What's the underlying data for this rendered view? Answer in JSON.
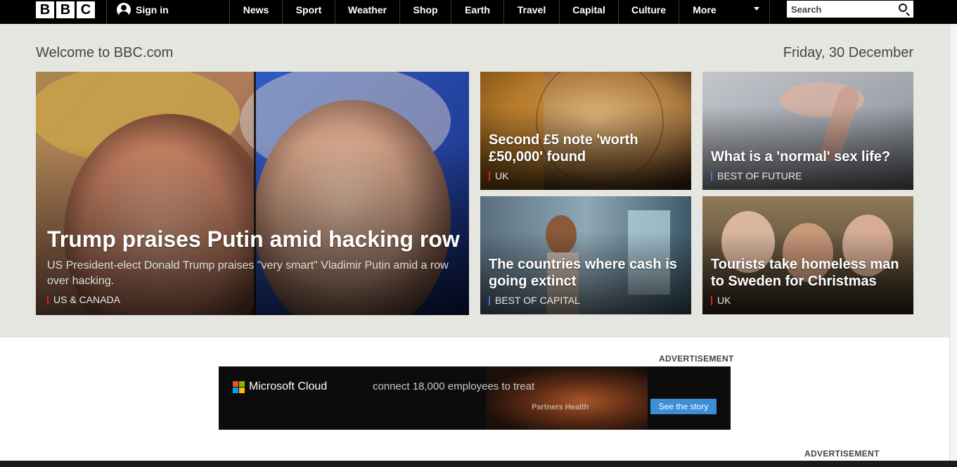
{
  "header": {
    "logo_letters": [
      "B",
      "B",
      "C"
    ],
    "sign_in": "Sign in",
    "nav": [
      "News",
      "Sport",
      "Weather",
      "Shop",
      "Earth",
      "Travel",
      "Capital",
      "Culture",
      "More"
    ],
    "search_placeholder": "Search"
  },
  "welcome": "Welcome to BBC.com",
  "date": "Friday, 30 December",
  "stories": {
    "main": {
      "headline": "Trump praises Putin amid hacking row",
      "summary": "US President-elect Donald Trump praises \"very smart\" Vladimir Putin amid a row over hacking.",
      "tag": "US & CANADA",
      "tag_color": "#e0201b"
    },
    "tiles": [
      {
        "headline": "Second £5 note 'worth £50,000' found",
        "tag": "UK",
        "tag_color": "#e0201b"
      },
      {
        "headline": "What is a 'normal' sex life?",
        "tag": "BEST OF FUTURE",
        "tag_color": "#3b7dc6"
      },
      {
        "headline": "The countries where cash is going extinct",
        "tag": "BEST OF CAPITAL",
        "tag_color": "#3b7dc6"
      },
      {
        "headline": "Tourists take homeless man to Sweden for Christmas",
        "tag": "UK",
        "tag_color": "#e0201b"
      }
    ]
  },
  "ads": {
    "label": "ADVERTISEMENT",
    "brand": "Microsoft Cloud",
    "tagline": "connect 18,000 employees to treat",
    "cta": "See the story",
    "photo_text": "Partners Health",
    "ms_colors": [
      "#f25022",
      "#7fba00",
      "#00a4ef",
      "#ffb900"
    ]
  },
  "colors": {
    "topbar": "#000000",
    "hero_background": "#e6e6e1",
    "accent_red": "#e0201b",
    "accent_blue": "#3b7dc6"
  }
}
